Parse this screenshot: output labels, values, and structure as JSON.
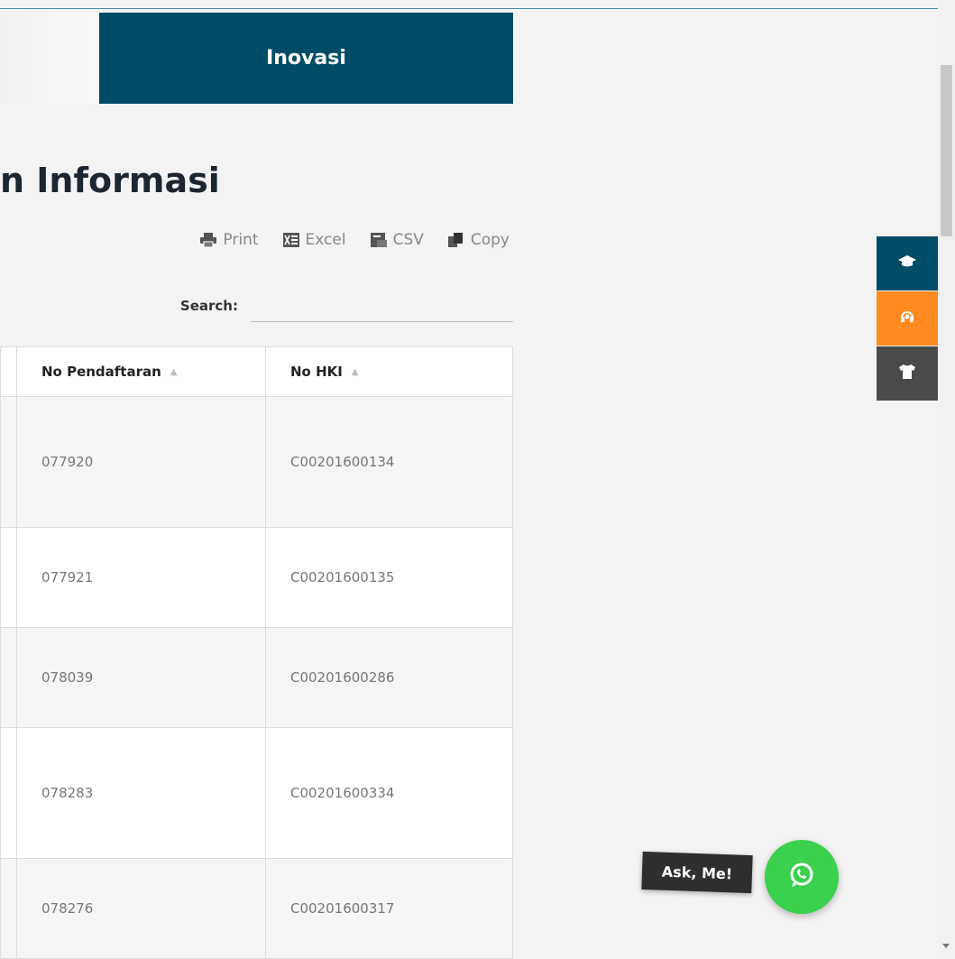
{
  "nav": {
    "active_menu": "Inovasi"
  },
  "page": {
    "title_visible": "n Informasi"
  },
  "toolbar": {
    "buttons": [
      {
        "label": "Print",
        "icon": "printer-icon"
      },
      {
        "label": "Excel",
        "icon": "excel-icon"
      },
      {
        "label": "CSV",
        "icon": "csv-icon"
      },
      {
        "label": "Copy",
        "icon": "copy-icon"
      }
    ]
  },
  "search": {
    "label": "Search:",
    "value": ""
  },
  "table": {
    "columns": [
      "No Pendaftaran",
      "No HKI"
    ],
    "rows": [
      {
        "no_pendaftaran": "077920",
        "no_hki": "C00201600134"
      },
      {
        "no_pendaftaran": "077921",
        "no_hki": "C00201600135"
      },
      {
        "no_pendaftaran": "078039",
        "no_hki": "C00201600286"
      },
      {
        "no_pendaftaran": "078283",
        "no_hki": "C00201600334"
      },
      {
        "no_pendaftaran": "078276",
        "no_hki": "C00201600317"
      }
    ]
  },
  "side_tabs": [
    {
      "icon": "graduation-cap-icon",
      "color": "#004c66"
    },
    {
      "icon": "headset-icon",
      "color": "#ff8a1f"
    },
    {
      "icon": "tshirt-icon",
      "color": "#4a4a4a"
    }
  ],
  "chat": {
    "label": "Ask, Me!",
    "icon": "whatsapp-icon",
    "color": "#3bd04e"
  },
  "colors": {
    "primary": "#004c66",
    "accent": "#ff8a1f",
    "background": "#f3f3f3"
  }
}
